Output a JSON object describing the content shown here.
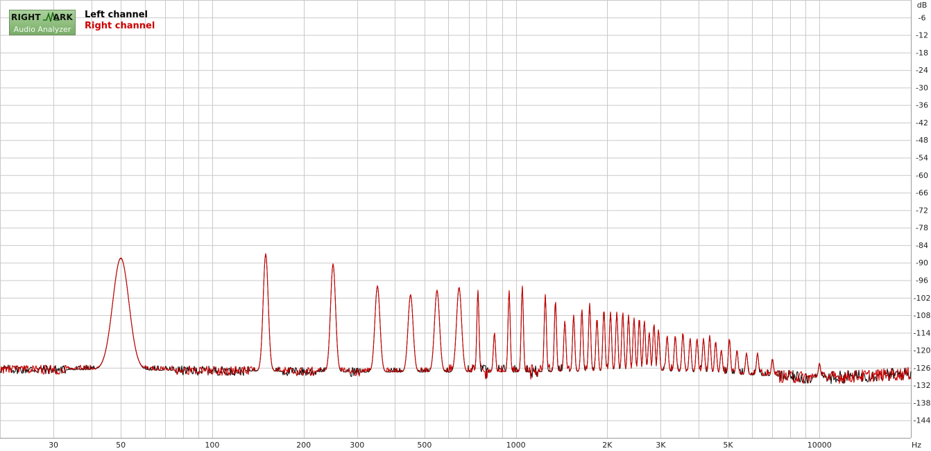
{
  "logo": {
    "top_left": "RIGHT",
    "top_right": "ARK",
    "bottom": "Audio Analyzer"
  },
  "chart_data": {
    "type": "line",
    "x_scale": "log",
    "y_unit": "dB",
    "x_unit": "Hz",
    "xlim": [
      20,
      20000
    ],
    "ylim": [
      -150,
      0
    ],
    "grid": true,
    "legend_placement": "top-left",
    "y_ticks": [
      -6,
      -12,
      -18,
      -24,
      -30,
      -36,
      -42,
      -48,
      -54,
      -60,
      -66,
      -72,
      -78,
      -84,
      -90,
      -96,
      -102,
      -108,
      -114,
      -120,
      -126,
      -132,
      -138,
      -144
    ],
    "y_tick_labels": [
      "-6",
      "-12",
      "-18",
      "-24",
      "-30",
      "-36",
      "-42",
      "-48",
      "-54",
      "-60",
      "-66",
      "-72",
      "-78",
      "-84",
      "-90",
      "-96",
      "-102",
      "-108",
      "-114",
      "-120",
      "-126",
      "-132",
      "-138",
      "-144"
    ],
    "x_ticks": [
      30,
      50,
      100,
      200,
      300,
      500,
      1000,
      2000,
      3000,
      5000,
      10000
    ],
    "x_tick_labels": [
      "30",
      "50",
      "100",
      "200",
      "300",
      "500",
      "1000",
      "2K",
      "3K",
      "5K",
      "10000"
    ],
    "noise_floor": {
      "x": [
        20,
        100,
        300,
        1000,
        3000,
        6000,
        10000,
        20000
      ],
      "y": [
        -126.5,
        -127,
        -127.5,
        -127.5,
        -127,
        -128.5,
        -129.5,
        -128
      ]
    },
    "peaks": {
      "x": [
        50,
        150,
        250,
        350,
        450,
        550,
        650,
        750,
        850,
        950,
        1050,
        1250,
        1350,
        1450,
        1550,
        1650,
        1750,
        1850,
        1950,
        2050,
        2150,
        2250,
        2350,
        2450,
        2550,
        2650,
        2750,
        2850,
        2950,
        3150,
        3350,
        3550,
        3750,
        3950,
        4150,
        4350,
        4550,
        4750,
        5050,
        5350,
        5750,
        6250,
        7000,
        10000
      ],
      "y": [
        -88.5,
        -87,
        -90.5,
        -98,
        -101,
        -99.5,
        -98.5,
        -99.5,
        -114,
        -99.5,
        -98,
        -101,
        -103,
        -110,
        -108,
        -106,
        -104,
        -109,
        -106,
        -107,
        -107,
        -107,
        -108,
        -109,
        -109,
        -110,
        -114,
        -111,
        -113,
        -115,
        -115,
        -114,
        -116,
        -116,
        -116,
        -115,
        -117,
        -120,
        -116,
        -120,
        -121,
        -121,
        -123,
        -124.5
      ]
    },
    "series": [
      {
        "name": "Left channel",
        "color": "#000000"
      },
      {
        "name": "Right channel",
        "color": "#cc0000"
      }
    ]
  }
}
